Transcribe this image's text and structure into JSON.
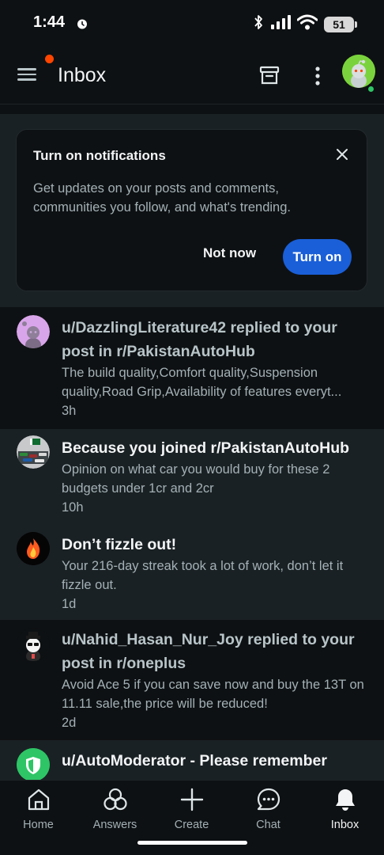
{
  "status_bar": {
    "time": "1:44",
    "battery": "51"
  },
  "header": {
    "title": "Inbox"
  },
  "notification_prompt": {
    "title": "Turn on notifications",
    "description": "Get updates on your posts and comments, communities you follow, and what's trending.",
    "dismiss_label": "Not now",
    "confirm_label": "Turn on"
  },
  "inbox_items": [
    {
      "title": "u/DazzlingLiterature42 replied to your post in r/PakistanAutoHub",
      "text": "The build quality,Comfort quality,Suspension quality,Road Grip,Availability of features everyt...",
      "time": "3h",
      "state": "read"
    },
    {
      "title": "Because you joined r/PakistanAutoHub",
      "text": "Opinion on what car you would buy for these 2 budgets under 1cr and 2cr",
      "time": "10h",
      "state": "unread"
    },
    {
      "title": "Don’t fizzle out!",
      "text": "Your 216-day streak took a lot of work, don’t let it fizzle out.",
      "time": "1d",
      "state": "unread"
    },
    {
      "title": "u/Nahid_Hasan_Nur_Joy replied to your post in r/oneplus",
      "text": "Avoid Ace 5 if you can save now and buy the 13T on 11.11 sale,the price will be reduced!",
      "time": "2d",
      "state": "read"
    },
    {
      "title": "u/AutoModerator - Please remember",
      "state": "unread"
    }
  ],
  "bottom_nav": [
    {
      "label": "Home",
      "icon": "home-icon"
    },
    {
      "label": "Answers",
      "icon": "answers-icon"
    },
    {
      "label": "Create",
      "icon": "plus-icon"
    },
    {
      "label": "Chat",
      "icon": "chat-icon"
    },
    {
      "label": "Inbox",
      "icon": "bell-icon",
      "active": true
    }
  ],
  "colors": {
    "accent_blue": "#1a5fd8",
    "notification_dot": "#ff4500",
    "online": "#2ec566"
  }
}
